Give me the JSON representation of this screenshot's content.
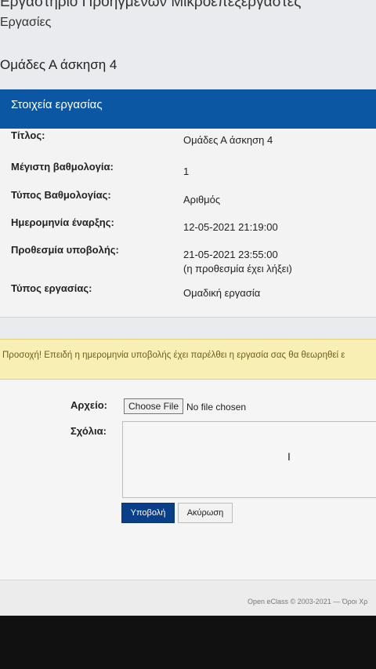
{
  "header": {
    "top_title": "Εργαστήριο Προηγμένων Μικροεπεξεργαστές",
    "breadcrumb": "Εργασίες",
    "page_title": "Ομάδες Α άσκηση 4"
  },
  "panel": {
    "title": "Στοιχεία εργασίας",
    "rows": [
      {
        "label": "Τίτλος:",
        "value": "Ομάδες Α άσκηση 4"
      },
      {
        "label": "Μέγιστη βαθμολογία:",
        "value": "1"
      },
      {
        "label": "Τύπος Βαθμολογίας:",
        "value": "Αριθμός"
      },
      {
        "label": "Ημερομηνία έναρξης:",
        "value": "12-05-2021 21:19:00"
      },
      {
        "label": "Προθεσμία υποβολής:",
        "value": "21-05-2021 23:55:00",
        "note": "(η προθεσμία έχει λήξει)"
      },
      {
        "label": "Τύπος εργασίας:",
        "value": "Ομαδική εργασία"
      }
    ]
  },
  "warning": {
    "text": "Προσοχή! Επειδή η ημερομηνία υποβολής έχει παρέλθει η εργασία σας θα θεωρηθεί ε"
  },
  "form": {
    "file_label": "Αρχείο:",
    "choose_file": "Choose File",
    "file_status": "No file chosen",
    "comments_label": "Σχόλια:",
    "submit": "Υποβολή",
    "cancel": "Ακύρωση"
  },
  "footer": {
    "text": "Open eClass © 2003-2021 — Όροι Χρ"
  },
  "colors": {
    "panel_header": "#0b57a4",
    "submit_button": "#0c3f8a",
    "warning_bg": "#f8efb5"
  },
  "icons": {
    "text_cursor": "I"
  }
}
